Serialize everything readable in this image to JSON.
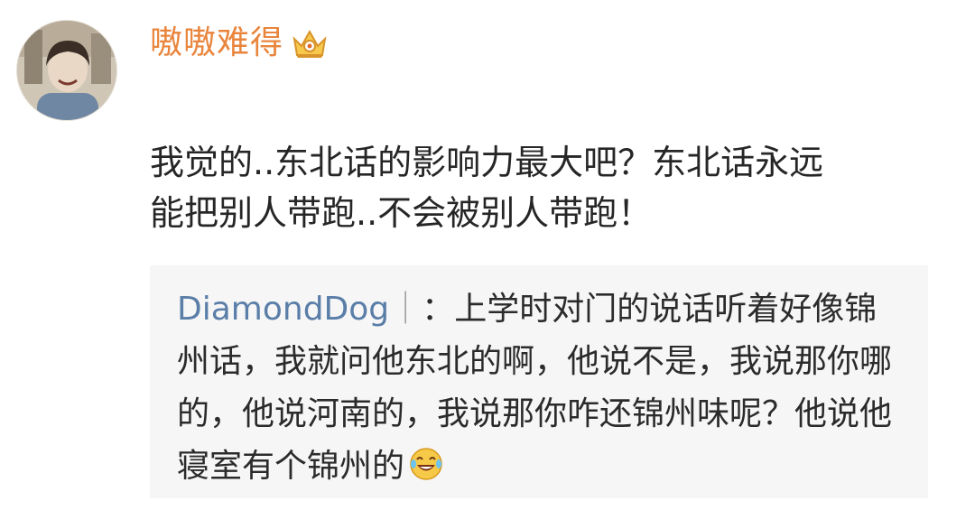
{
  "post": {
    "username": "嗷嗷难得",
    "badge_icon": "vip-crown-icon",
    "comment_lines": [
      "我觉的..东北话的影响力最大吧？东北话永远",
      "能把别人带跑..不会被别人带跑！"
    ]
  },
  "repost": {
    "user": "DiamondDog",
    "separator": "｜",
    "colon": "：",
    "text": "上学时对门的说话听着好像锦州话，我就问他东北的啊，他说不是，我说那你哪的，他说河南的，我说那你咋还锦州味呢？他说他寝室有个锦州的",
    "trailing_icon": "laugh-tears-emoji-icon"
  },
  "colors": {
    "username": "#e9853c",
    "repost_user": "#5a7ea8",
    "repost_bg": "#f6f6f6",
    "text": "#262626"
  }
}
